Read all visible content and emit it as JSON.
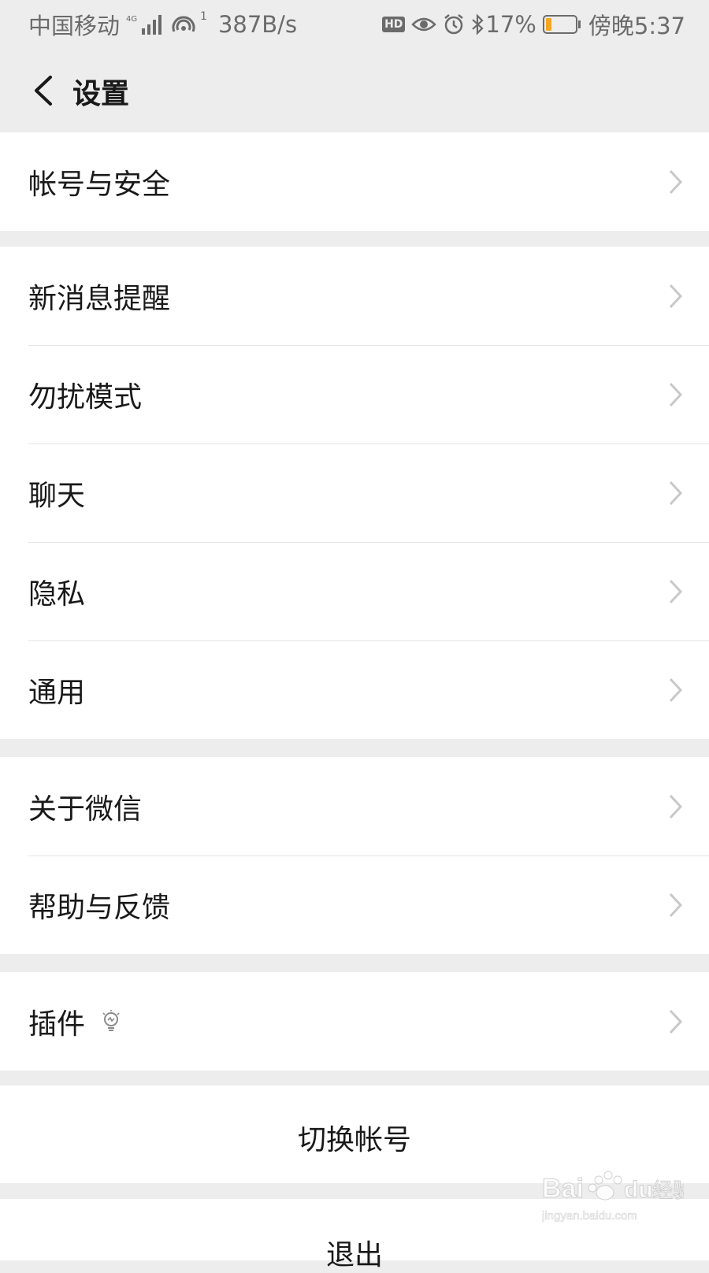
{
  "status_bar": {
    "carrier": "中国移动",
    "network": "4G",
    "hotspot_sup": "1",
    "speed": "387B/s",
    "hd_badge": "HD",
    "battery": "17%",
    "time": "傍晚5:37"
  },
  "nav": {
    "title": "设置"
  },
  "groups": {
    "account": {
      "items": [
        {
          "label": "帐号与安全"
        }
      ]
    },
    "main": {
      "items": [
        {
          "label": "新消息提醒"
        },
        {
          "label": "勿扰模式"
        },
        {
          "label": "聊天"
        },
        {
          "label": "隐私"
        },
        {
          "label": "通用"
        }
      ]
    },
    "about": {
      "items": [
        {
          "label": "关于微信"
        },
        {
          "label": "帮助与反馈"
        }
      ]
    },
    "plugins": {
      "items": [
        {
          "label": "插件"
        }
      ]
    }
  },
  "actions": {
    "switch_account": "切换帐号",
    "logout": "退出"
  },
  "colors": {
    "background": "#ededed",
    "card": "#ffffff",
    "battery_low": "#f5a623"
  }
}
